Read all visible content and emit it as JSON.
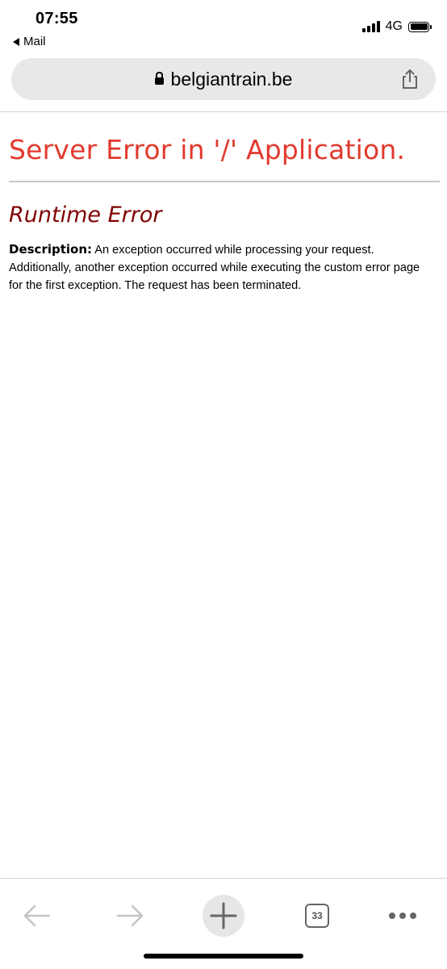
{
  "status_bar": {
    "time": "07:55",
    "back_app": "Mail",
    "network": "4G"
  },
  "browser": {
    "url": "belgiantrain.be"
  },
  "page": {
    "title": "Server Error in '/' Application.",
    "subtitle": "Runtime Error",
    "description_label": "Description:",
    "description_text": "An exception occurred while processing your request. Additionally, another exception occurred while executing the custom error page for the first exception. The request has been terminated."
  },
  "toolbar": {
    "tab_count": "33"
  },
  "colors": {
    "title": "#e23a2e",
    "subtitle": "#800000",
    "url_bar_bg": "#e8e8ea",
    "toolbar_icon": "#666666"
  },
  "icons": [
    "lock-icon",
    "share-icon",
    "back-arrow-icon",
    "forward-arrow-icon",
    "new-tab-plus-icon",
    "tabs-icon",
    "more-icon"
  ]
}
